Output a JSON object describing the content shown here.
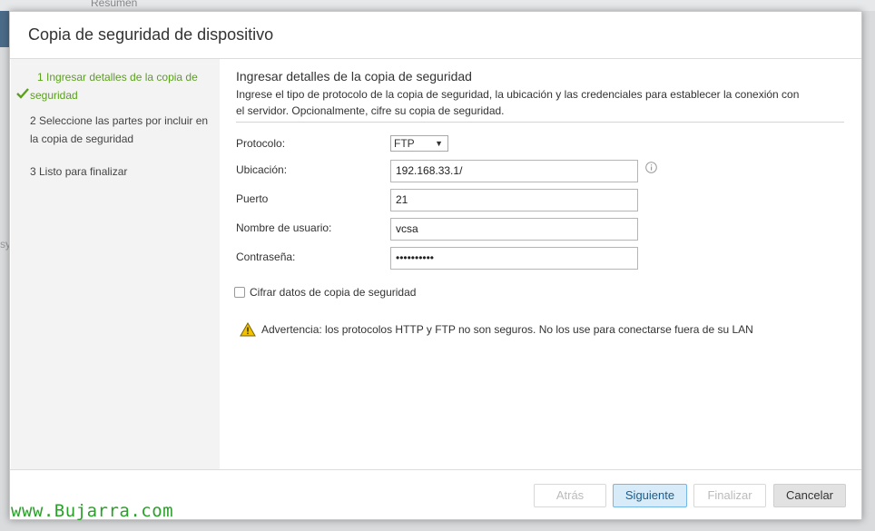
{
  "background": {
    "top_label": "Resumen",
    "left_text": "sy"
  },
  "dialog": {
    "title": "Copia de seguridad de dispositivo"
  },
  "steps": [
    {
      "number": "1",
      "line1": "1 Ingresar detalles de la copia de",
      "line2": "seguridad",
      "state": "completed"
    },
    {
      "number": "2",
      "label": "2 Seleccione las partes por incluir en la copia de seguridad",
      "state": "pending"
    },
    {
      "number": "3",
      "label": "3 Listo para finalizar",
      "state": "pending"
    }
  ],
  "content": {
    "title": "Ingresar detalles de la copia de seguridad",
    "description": "Ingrese el tipo de protocolo de la copia de seguridad, la ubicación y las credenciales para establecer la conexión con el servidor. Opcionalmente, cifre su copia de seguridad.",
    "fields": {
      "protocol": {
        "label": "Protocolo:",
        "value": "FTP"
      },
      "location": {
        "label": "Ubicación:",
        "value": "192.168.33.1/"
      },
      "port": {
        "label": "Puerto",
        "value": "21"
      },
      "username": {
        "label": "Nombre de usuario:",
        "value": "vcsa"
      },
      "password": {
        "label": "Contraseña:",
        "value": "••••••••••"
      }
    },
    "encrypt_label": "Cifrar datos de copia de seguridad",
    "warning": "Advertencia: los protocolos HTTP y FTP no son seguros. No los use para conectarse fuera de su LAN"
  },
  "footer": {
    "back": "Atrás",
    "next": "Siguiente",
    "finish": "Finalizar",
    "cancel": "Cancelar"
  },
  "watermark": "www.Bujarra.com",
  "colors": {
    "accent_green": "#5aa11a",
    "next_button_bg": "#d7ebf8",
    "warning_yellow": "#f2c200"
  }
}
